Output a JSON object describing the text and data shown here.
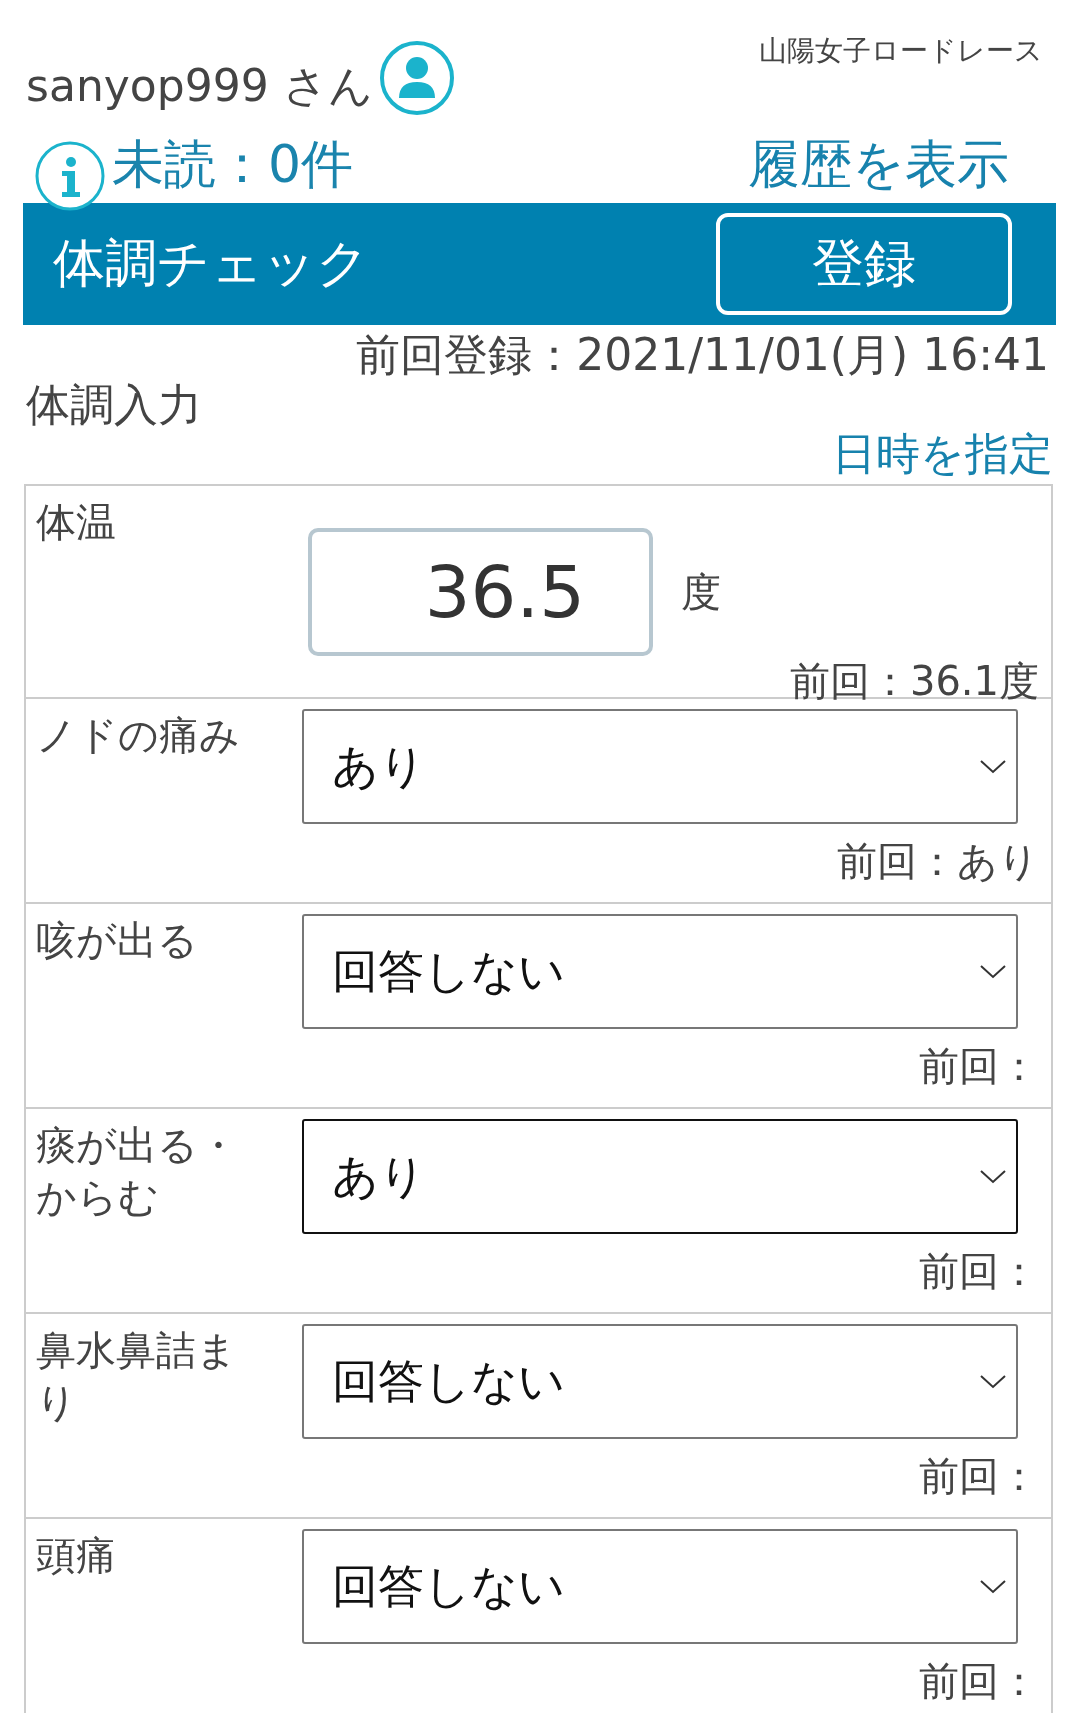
{
  "event_name": "山陽女子ロードレース",
  "user": {
    "name": "sanyop999 さん"
  },
  "unread": {
    "text": "未読：0件"
  },
  "history_link": "履歴を表示",
  "header_bar": {
    "title": "体調チェック",
    "button": "登録"
  },
  "last_registered": "前回登録：2021/11/01(月) 16:41",
  "section_title": "体調入力",
  "datetime_link": "日時を指定",
  "rows": [
    {
      "kind": "number",
      "label": "体温",
      "value": "36.5",
      "unit": "度",
      "previous": "前回：36.1度"
    },
    {
      "kind": "select",
      "label": "ノドの痛み",
      "value": "あり",
      "focused": false,
      "previous": "前回：あり"
    },
    {
      "kind": "select",
      "label": "咳が出る",
      "value": "回答しない",
      "focused": false,
      "previous": "前回："
    },
    {
      "kind": "select",
      "label": "痰が出る・からむ",
      "value": "あり",
      "focused": true,
      "previous": "前回："
    },
    {
      "kind": "select",
      "label": "鼻水鼻詰まり",
      "value": "回答しない",
      "focused": false,
      "previous": "前回："
    },
    {
      "kind": "select",
      "label": "頭痛",
      "value": "回答しない",
      "focused": false,
      "previous": "前回："
    }
  ]
}
